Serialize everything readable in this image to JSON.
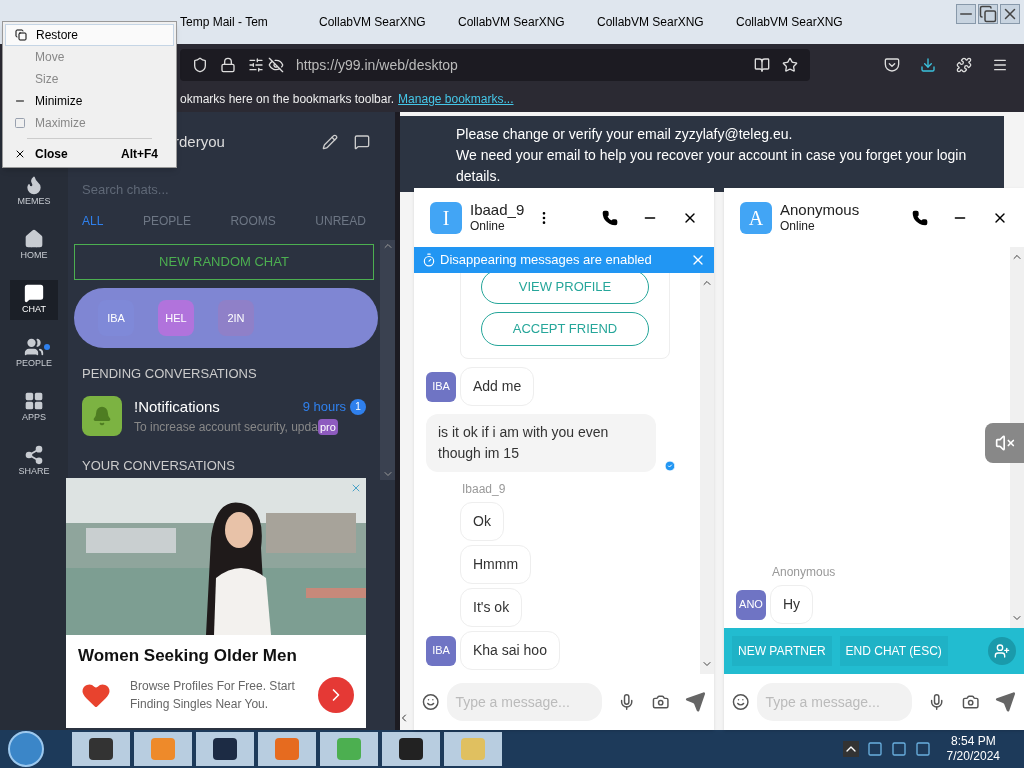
{
  "browser": {
    "tabs": [
      {
        "label": "Temp Mail - Tem",
        "selected": false
      },
      {
        "label": "CollabVM SearXNG",
        "selected": false
      },
      {
        "label": "CollabVM SearXNG",
        "selected": false
      },
      {
        "label": "CollabVM SearXNG",
        "selected": false
      },
      {
        "label": "CollabVM SearXNG",
        "selected": false
      }
    ],
    "url": "https://y99.in/web/desktop",
    "bookmarks_hint": "okmarks here on the bookmarks toolbar.",
    "manage_link": "Manage bookmarks..."
  },
  "system_menu": [
    {
      "label": "Restore",
      "disabled": false,
      "highlighted": true,
      "kind": "restore"
    },
    {
      "label": "Move",
      "disabled": true,
      "highlighted": false,
      "kind": "none"
    },
    {
      "label": "Size",
      "disabled": true,
      "highlighted": false,
      "kind": "none"
    },
    {
      "label": "Minimize",
      "disabled": false,
      "highlighted": false,
      "kind": "minimize"
    },
    {
      "label": "Maximize",
      "disabled": true,
      "highlighted": false,
      "kind": "maximize"
    },
    {
      "label": "Close",
      "disabled": false,
      "highlighted": false,
      "kind": "close",
      "shortcut": "Alt+F4"
    }
  ],
  "rail": [
    {
      "label": "MEMES",
      "kind": "flame",
      "selected": false,
      "badge": false
    },
    {
      "label": "HOME",
      "kind": "home",
      "selected": false,
      "badge": false
    },
    {
      "label": "CHAT",
      "kind": "chat",
      "selected": true,
      "badge": false
    },
    {
      "label": "PEOPLE",
      "kind": "people",
      "selected": false,
      "badge": true
    },
    {
      "label": "APPS",
      "kind": "apps",
      "selected": false,
      "badge": false
    },
    {
      "label": "SHARE",
      "kind": "share",
      "selected": false,
      "badge": false
    }
  ],
  "chat_list": {
    "username": "rderyou",
    "search_placeholder": "Search chats...",
    "filters": [
      {
        "label": "ALL",
        "selected": true
      },
      {
        "label": "PEOPLE",
        "selected": false
      },
      {
        "label": "ROOMS",
        "selected": false
      },
      {
        "label": "UNREAD",
        "selected": false
      }
    ],
    "new_chat": "NEW RANDOM CHAT",
    "active": [
      {
        "label": "IBA",
        "color": "#7f89d8"
      },
      {
        "label": "HEL",
        "color": "#b173dc"
      },
      {
        "label": "2IN",
        "color": "#8f80c8"
      }
    ],
    "pending_title": "PENDING CONVERSATIONS",
    "pending": [
      {
        "name": "!Notifications",
        "time": "9 hours",
        "count": "1",
        "preview": "To increase account security, upda",
        "badge": "pro"
      }
    ],
    "yours_title": "YOUR CONVERSATIONS"
  },
  "notice": {
    "line1": "Please change or verify your email zyzylafy@teleg.eu.",
    "line2": "We need your email to help you recover your account in case you forget your login details."
  },
  "chat_windows": [
    {
      "initial": "I",
      "name": "Ibaad_9",
      "status": "Online",
      "menu": true,
      "banner": "Disappearing messages are enabled",
      "actions": [
        "VIEW PROFILE",
        "ACCEPT FRIEND"
      ],
      "messages": [
        {
          "kind": "in",
          "text": "Add me",
          "avatar": "IBA"
        },
        {
          "kind": "out",
          "text": "is it ok if i am with you even though im 15",
          "read": true
        },
        {
          "kind": "sender",
          "text": "Ibaad_9"
        },
        {
          "kind": "in",
          "text": "Ok"
        },
        {
          "kind": "in",
          "text": "Hmmm"
        },
        {
          "kind": "in",
          "text": "It's ok"
        },
        {
          "kind": "in",
          "text": "Kha sai hoo",
          "avatar": "IBA"
        }
      ],
      "placeholder": "Type a message..."
    },
    {
      "initial": "A",
      "name": "Anonymous",
      "status": "Online",
      "menu": false,
      "messages": [
        {
          "kind": "sender",
          "text": "Anonymous"
        },
        {
          "kind": "in",
          "text": "Hy",
          "avatar": "ANO"
        }
      ],
      "footer_buttons": [
        "NEW PARTNER",
        "END CHAT (ESC)"
      ],
      "placeholder": "Type a message..."
    }
  ],
  "ad": {
    "headline": "Women Seeking Older Men",
    "body": "Browse Profiles For Free. Start Finding Singles Near You."
  },
  "taskbar": {
    "time": "8:54 PM",
    "date": "7/20/2024"
  }
}
